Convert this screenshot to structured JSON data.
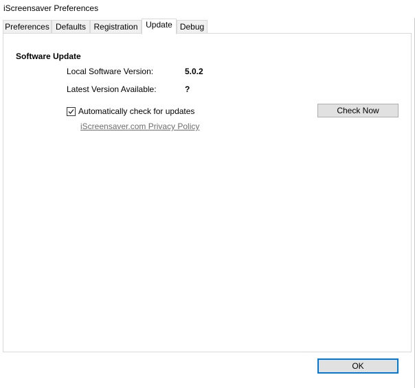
{
  "window": {
    "title": "iScreensaver Preferences"
  },
  "tabs": [
    {
      "label": "Preferences",
      "active": false
    },
    {
      "label": "Defaults",
      "active": false
    },
    {
      "label": "Registration",
      "active": false
    },
    {
      "label": "Update",
      "active": true
    },
    {
      "label": "Debug",
      "active": false
    }
  ],
  "update": {
    "section_title": "Software Update",
    "local_version_label": "Local Software Version:",
    "local_version_value": "5.0.2",
    "latest_version_label": "Latest Version Available:",
    "latest_version_value": "?",
    "auto_check_label": "Automatically check for updates",
    "auto_check_checked": true,
    "check_now_label": "Check Now",
    "privacy_link_label": "iScreensaver.com Privacy Policy"
  },
  "footer": {
    "ok_label": "OK"
  },
  "colors": {
    "accent": "#0078d7",
    "link": "#6d6d6d",
    "button_face": "#e1e1e1",
    "tab_inactive": "#f0f0f0",
    "border": "#d9d9d9"
  }
}
